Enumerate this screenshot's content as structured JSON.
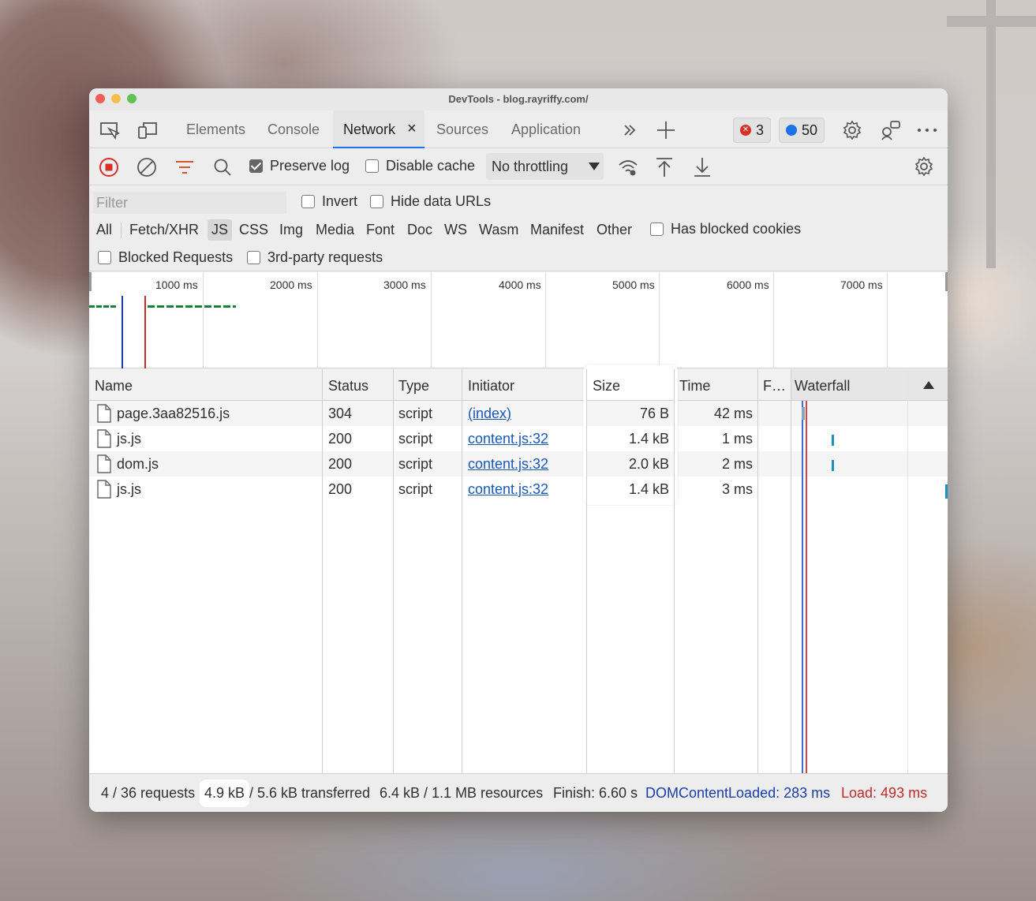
{
  "window": {
    "title": "DevTools - blog.rayriffy.com/"
  },
  "tabs": [
    {
      "label": "Elements"
    },
    {
      "label": "Console"
    },
    {
      "label": "Network",
      "close": "×"
    },
    {
      "label": "Sources"
    },
    {
      "label": "Application"
    }
  ],
  "badges": {
    "errors": "3",
    "messages": "50"
  },
  "toolbar": {
    "preserve_log": "Preserve log",
    "preserve_log_checked": true,
    "disable_cache": "Disable cache",
    "throttling": "No throttling"
  },
  "filter": {
    "placeholder": "Filter",
    "invert": "Invert",
    "hide_data_urls": "Hide data URLs",
    "types": [
      "All",
      "Fetch/XHR",
      "JS",
      "CSS",
      "Img",
      "Media",
      "Font",
      "Doc",
      "WS",
      "Wasm",
      "Manifest",
      "Other"
    ],
    "selected_type": "JS",
    "has_blocked_cookies": "Has blocked cookies",
    "blocked_requests": "Blocked Requests",
    "third_party": "3rd-party requests"
  },
  "overview": {
    "ticks": [
      "1000 ms",
      "2000 ms",
      "3000 ms",
      "4000 ms",
      "5000 ms",
      "6000 ms",
      "7000 ms"
    ]
  },
  "table": {
    "headers": {
      "name": "Name",
      "status": "Status",
      "type": "Type",
      "initiator": "Initiator",
      "size": "Size",
      "time": "Time",
      "fulfilled": "F…",
      "waterfall": "Waterfall"
    },
    "rows": [
      {
        "name": "page.3aa82516.js",
        "status": "304",
        "type": "script",
        "initiator": "(index)",
        "size": "76 B",
        "time": "42 ms"
      },
      {
        "name": "js.js",
        "status": "200",
        "type": "script",
        "initiator": "content.js:32",
        "size": "1.4 kB",
        "time": "1 ms"
      },
      {
        "name": "dom.js",
        "status": "200",
        "type": "script",
        "initiator": "content.js:32",
        "size": "2.0 kB",
        "time": "2 ms"
      },
      {
        "name": "js.js",
        "status": "200",
        "type": "script",
        "initiator": "content.js:32",
        "size": "1.4 kB",
        "time": "3 ms"
      }
    ]
  },
  "footer": {
    "requests": "4 / 36 requests",
    "transferred_highlight": "4.9 kB",
    "transferred_rest": "/ 5.6 kB transferred",
    "resources": "6.4 kB / 1.1 MB resources",
    "finish": "Finish: 6.60 s",
    "dom_content_loaded": "DOMContentLoaded: 283 ms",
    "load": "Load: 493 ms"
  },
  "colors": {
    "accent": "#1a73e8",
    "dcl": "#1a3ea8",
    "load": "#c22b2b",
    "record": "#d93025"
  }
}
